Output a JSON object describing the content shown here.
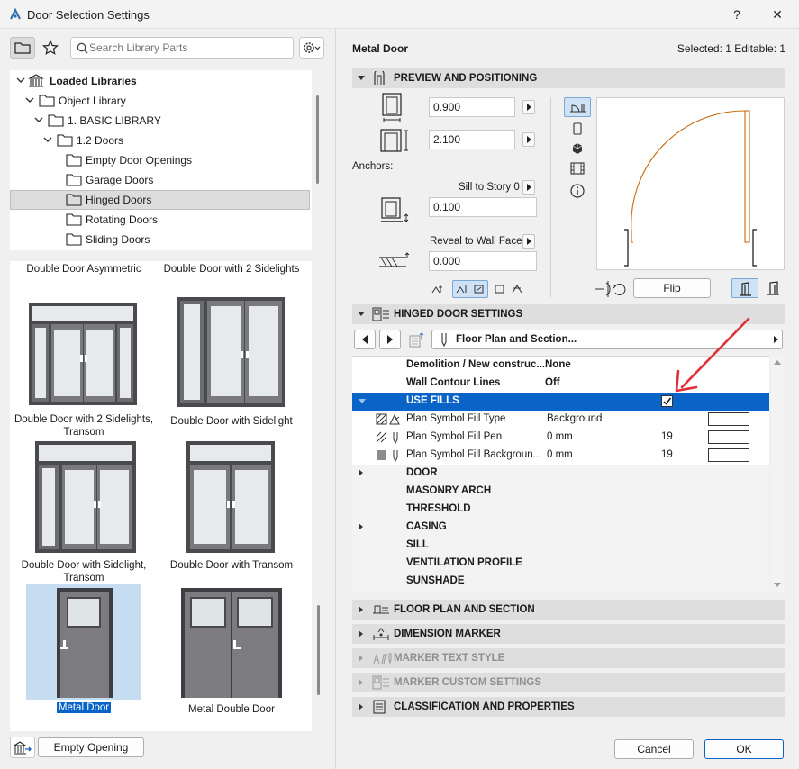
{
  "window": {
    "title": "Door Selection Settings",
    "help": "?",
    "close": "✕"
  },
  "library": {
    "search_placeholder": "Search Library Parts",
    "tree": [
      {
        "label": "Loaded Libraries"
      },
      {
        "label": "Object Library"
      },
      {
        "label": "1. BASIC LIBRARY"
      },
      {
        "label": "1.2 Doors"
      },
      {
        "label": "Empty Door Openings"
      },
      {
        "label": "Garage Doors"
      },
      {
        "label": "Hinged Doors"
      },
      {
        "label": "Rotating Doors"
      },
      {
        "label": "Sliding Doors"
      }
    ],
    "items": [
      {
        "label": "Double Door Asymmetric"
      },
      {
        "label": "Double Door with 2 Sidelights"
      },
      {
        "label": "Double Door with 2 Sidelights, Transom"
      },
      {
        "label": "Double Door with Sidelight"
      },
      {
        "label": "Double Door with Sidelight, Transom"
      },
      {
        "label": "Double Door with Transom"
      },
      {
        "label": "Metal Door"
      },
      {
        "label": "Metal Double Door"
      }
    ],
    "empty_opening_button": "Empty Opening"
  },
  "header": {
    "name": "Metal Door",
    "status": "Selected: 1 Editable: 1"
  },
  "preview": {
    "section_title": "PREVIEW AND POSITIONING",
    "width": "0.900",
    "height": "2.100",
    "anchors_label": "Anchors:",
    "sill_label": "Sill to Story 0",
    "sill_value": "0.100",
    "reveal_label": "Reveal to Wall Face",
    "reveal_value": "0.000",
    "flip_button": "Flip"
  },
  "hinged": {
    "section_title": "HINGED DOOR SETTINGS",
    "dropdown": "Floor Plan and Section...",
    "params": [
      {
        "name": "Demolition / New construc...",
        "value": "None"
      },
      {
        "name": "Wall Contour Lines",
        "value": "Off"
      },
      {
        "name": "USE FILLS",
        "value": ""
      },
      {
        "name": "Plan Symbol Fill Type",
        "value": "Background"
      },
      {
        "name": "Plan Symbol Fill Pen",
        "value": "0 mm",
        "num": "19"
      },
      {
        "name": "Plan Symbol Fill Backgroun...",
        "value": "0 mm",
        "num": "19"
      },
      {
        "name": "DOOR"
      },
      {
        "name": "MASONRY ARCH"
      },
      {
        "name": "THRESHOLD"
      },
      {
        "name": "CASING"
      },
      {
        "name": "SILL"
      },
      {
        "name": "VENTILATION PROFILE"
      },
      {
        "name": "SUNSHADE"
      }
    ]
  },
  "sections": [
    {
      "label": "FLOOR PLAN AND SECTION"
    },
    {
      "label": "DIMENSION MARKER"
    },
    {
      "label": "MARKER TEXT STYLE"
    },
    {
      "label": "MARKER CUSTOM SETTINGS"
    },
    {
      "label": "CLASSIFICATION AND PROPERTIES"
    }
  ],
  "footer": {
    "cancel": "Cancel",
    "ok": "OK"
  },
  "colors": {
    "accent": "#0a64c8",
    "selection": "#c6ddf1",
    "annotation_arrow": "#e0303a",
    "door_line": "#c86a10"
  }
}
